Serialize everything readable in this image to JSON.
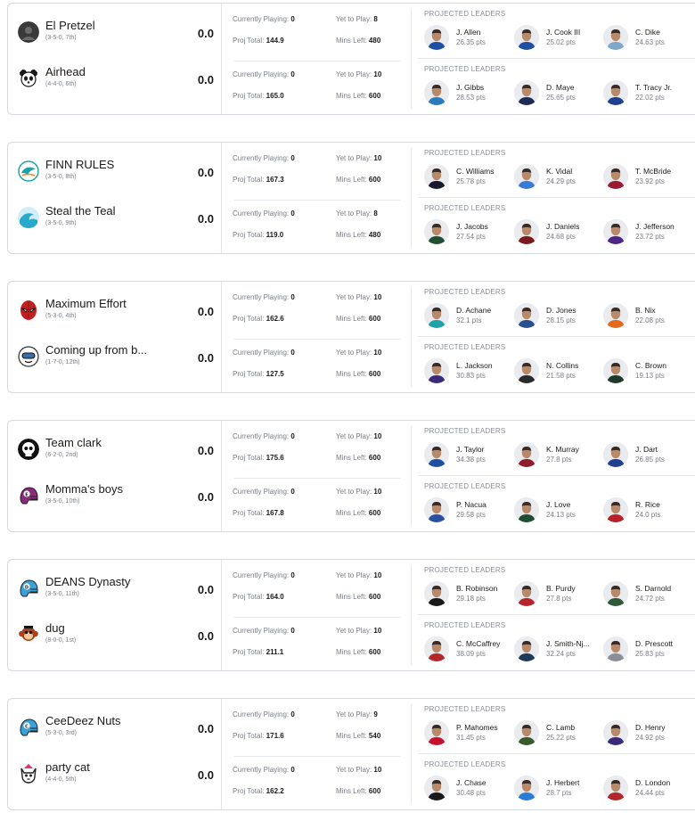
{
  "labels": {
    "currently_playing": "Currently Playing:",
    "yet_to_play": "Yet to Play:",
    "proj_total": "Proj Total:",
    "mins_left": "Mins Left:",
    "projected_leaders": "PROJECTED LEADERS"
  },
  "matchups": [
    {
      "teams": [
        {
          "name": "El Pretzel",
          "record": "(3-5-0, 7th)",
          "score": "0.0",
          "icon": "dark-photo-avatar-icon",
          "color": "#3a3a3a",
          "currently_playing": "0",
          "yet_to_play": "8",
          "proj_total": "144.9",
          "mins_left": "480",
          "leaders": [
            {
              "name": "J. Allen",
              "pts": "26.35 pts",
              "jersey": "#1f4fa3"
            },
            {
              "name": "J. Cook III",
              "pts": "25.02 pts",
              "jersey": "#1f4fa3"
            },
            {
              "name": "C. Dike",
              "pts": "24.63 pts",
              "jersey": "#7fa7c9"
            }
          ]
        },
        {
          "name": "Airhead",
          "record": "(4-4-0, 6th)",
          "score": "0.0",
          "icon": "panda-avatar-icon",
          "color": "#1a1a1a",
          "currently_playing": "0",
          "yet_to_play": "10",
          "proj_total": "165.0",
          "mins_left": "600",
          "leaders": [
            {
              "name": "J. Gibbs",
              "pts": "28.53 pts",
              "jersey": "#2b7bbf"
            },
            {
              "name": "D. Maye",
              "pts": "25.65 pts",
              "jersey": "#1d2c57"
            },
            {
              "name": "T. Tracy Jr.",
              "pts": "22.02 pts",
              "jersey": "#1f3f8f"
            }
          ]
        }
      ]
    },
    {
      "teams": [
        {
          "name": "FINN RULES",
          "record": "(3-5-0, 8th)",
          "score": "0.0",
          "icon": "dolphin-avatar-icon",
          "color": "#1aa3a8",
          "currently_playing": "0",
          "yet_to_play": "10",
          "proj_total": "167.3",
          "mins_left": "600",
          "leaders": [
            {
              "name": "C. Williams",
              "pts": "25.78 pts",
              "jersey": "#1a1a2e"
            },
            {
              "name": "K. Vidal",
              "pts": "24.29 pts",
              "jersey": "#3a7bd5"
            },
            {
              "name": "T. McBride",
              "pts": "23.92 pts",
              "jersey": "#9b1b30"
            }
          ]
        },
        {
          "name": "Steal the Teal",
          "record": "(3-5-0, 9th)",
          "score": "0.0",
          "icon": "wave-avatar-icon",
          "color": "#29a9c9",
          "currently_playing": "0",
          "yet_to_play": "8",
          "proj_total": "119.0",
          "mins_left": "480",
          "leaders": [
            {
              "name": "J. Jacobs",
              "pts": "27.54 pts",
              "jersey": "#204e32"
            },
            {
              "name": "J. Daniels",
              "pts": "24.68 pts",
              "jersey": "#7a1a1a"
            },
            {
              "name": "J. Jefferson",
              "pts": "23.72 pts",
              "jersey": "#4f2683"
            }
          ]
        }
      ]
    },
    {
      "teams": [
        {
          "name": "Maximum Effort",
          "record": "(5-3-0, 4th)",
          "score": "0.0",
          "icon": "masked-hero-avatar-icon",
          "color": "#c0201f",
          "currently_playing": "0",
          "yet_to_play": "10",
          "proj_total": "162.6",
          "mins_left": "600",
          "leaders": [
            {
              "name": "D. Achane",
              "pts": "32.1 pts",
              "jersey": "#1fa3a8"
            },
            {
              "name": "D. Jones",
              "pts": "28.15 pts",
              "jersey": "#2a4f8f"
            },
            {
              "name": "B. Nix",
              "pts": "22.08 pts",
              "jersey": "#e06a1e"
            }
          ]
        },
        {
          "name": "Coming up from b...",
          "record": "(1-7-0, 12th)",
          "score": "0.0",
          "icon": "diver-avatar-icon",
          "color": "#3b6ea8",
          "currently_playing": "0",
          "yet_to_play": "10",
          "proj_total": "127.5",
          "mins_left": "600",
          "leaders": [
            {
              "name": "L. Jackson",
              "pts": "30.83 pts",
              "jersey": "#3b2a7a"
            },
            {
              "name": "N. Collins",
              "pts": "21.58 pts",
              "jersey": "#2a2a2a"
            },
            {
              "name": "C. Brown",
              "pts": "19.13 pts",
              "jersey": "#1f3a2a"
            }
          ]
        }
      ]
    },
    {
      "teams": [
        {
          "name": "Team clark",
          "record": "(6-2-0, 2nd)",
          "score": "0.0",
          "icon": "skull-avatar-icon",
          "color": "#111111",
          "currently_playing": "0",
          "yet_to_play": "10",
          "proj_total": "175.6",
          "mins_left": "600",
          "leaders": [
            {
              "name": "J. Taylor",
              "pts": "34.38 pts",
              "jersey": "#1f4fa3"
            },
            {
              "name": "K. Murray",
              "pts": "27.8 pts",
              "jersey": "#8f1d2c"
            },
            {
              "name": "J. Dart",
              "pts": "26.85 pts",
              "jersey": "#1f3f8f"
            }
          ]
        },
        {
          "name": "Momma's boys",
          "record": "(3-5-0, 10th)",
          "score": "0.0",
          "icon": "helmet-avatar-icon",
          "color": "#8a2a7a",
          "currently_playing": "0",
          "yet_to_play": "10",
          "proj_total": "167.8",
          "mins_left": "600",
          "leaders": [
            {
              "name": "P. Nacua",
              "pts": "29.58 pts",
              "jersey": "#2a4fa3"
            },
            {
              "name": "J. Love",
              "pts": "24.13 pts",
              "jersey": "#204e32"
            },
            {
              "name": "R. Rice",
              "pts": "24.0 pts",
              "jersey": "#b8202a"
            }
          ]
        }
      ]
    },
    {
      "teams": [
        {
          "name": "DEANS Dynasty",
          "record": "(3-5-0, 11th)",
          "score": "0.0",
          "icon": "d-helmet-avatar-icon",
          "color": "#3aa0d8",
          "currently_playing": "0",
          "yet_to_play": "10",
          "proj_total": "164.0",
          "mins_left": "600",
          "leaders": [
            {
              "name": "B. Robinson",
              "pts": "29.18 pts",
              "jersey": "#1a1a1a"
            },
            {
              "name": "B. Purdy",
              "pts": "27.8 pts",
              "jersey": "#b3262a"
            },
            {
              "name": "S. Darnold",
              "pts": "24.72 pts",
              "jersey": "#2f5a3a"
            }
          ]
        },
        {
          "name": "dug",
          "record": "(8-0-0, 1st)",
          "score": "0.0",
          "icon": "monkey-avatar-icon",
          "color": "#a8421a",
          "currently_playing": "0",
          "yet_to_play": "10",
          "proj_total": "211.1",
          "mins_left": "600",
          "leaders": [
            {
              "name": "C. McCaffrey",
              "pts": "38.09 pts",
              "jersey": "#b3262a"
            },
            {
              "name": "J. Smith-Nj...",
              "pts": "32.24 pts",
              "jersey": "#1d3a5a"
            },
            {
              "name": "D. Prescott",
              "pts": "25.83 pts",
              "jersey": "#8a8f96"
            }
          ]
        }
      ]
    },
    {
      "teams": [
        {
          "name": "CeeDeez Nuts",
          "record": "(5-3-0, 3rd)",
          "score": "0.0",
          "icon": "c-helmet-avatar-icon",
          "color": "#3aa0d8",
          "currently_playing": "0",
          "yet_to_play": "9",
          "proj_total": "171.6",
          "mins_left": "540",
          "leaders": [
            {
              "name": "P. Mahomes",
              "pts": "31.45 pts",
              "jersey": "#c8102e"
            },
            {
              "name": "C. Lamb",
              "pts": "25.22 pts",
              "jersey": "#3a5a2a"
            },
            {
              "name": "D. Henry",
              "pts": "24.92 pts",
              "jersey": "#3b2a7a"
            }
          ]
        },
        {
          "name": "party cat",
          "record": "(4-4-0, 5th)",
          "score": "0.0",
          "icon": "cat-avatar-icon",
          "color": "#222222",
          "currently_playing": "0",
          "yet_to_play": "10",
          "proj_total": "162.2",
          "mins_left": "600",
          "leaders": [
            {
              "name": "J. Chase",
              "pts": "30.48 pts",
              "jersey": "#1a1a1a"
            },
            {
              "name": "J. Herbert",
              "pts": "28.7 pts",
              "jersey": "#2a7bd5"
            },
            {
              "name": "D. London",
              "pts": "24.44 pts",
              "jersey": "#b3262a"
            }
          ]
        }
      ]
    }
  ]
}
